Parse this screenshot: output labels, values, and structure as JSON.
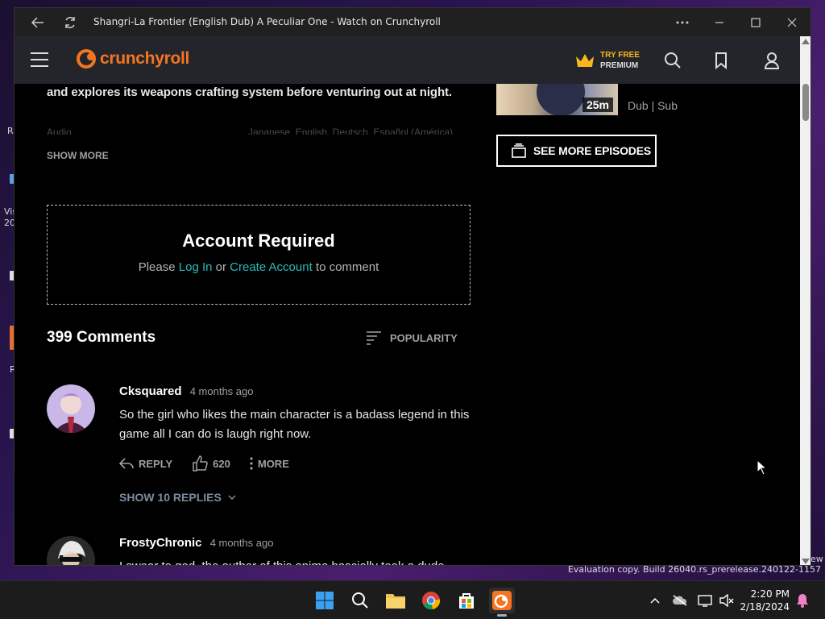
{
  "window": {
    "title": "Shangri-La Frontier (English Dub) A Peculiar One - Watch on Crunchyroll"
  },
  "header": {
    "logo_text": "crunchyroll",
    "premium_try": "TRY FREE",
    "premium_label": "PREMIUM"
  },
  "episode": {
    "description_tail": "and explores its weapons crafting system before venturing out at night.",
    "audio_label": "Audio",
    "audio_values": "Japanese, English, Deutsch, Español (América)",
    "show_more": "SHOW MORE",
    "thumb_duration": "25m",
    "dub_sub": "Dub | Sub",
    "see_more_episodes": "SEE MORE EPISODES"
  },
  "account": {
    "title": "Account Required",
    "prefix": "Please",
    "login": "Log In",
    "or": "or",
    "create": "Create Account",
    "suffix": "to comment"
  },
  "comments": {
    "count_label": "399 Comments",
    "sort_label": "POPULARITY",
    "items": [
      {
        "user": "Cksquared",
        "time": "4 months ago",
        "body": "So the girl who likes the main character is a badass legend in this game all I can do is laugh right now.",
        "reply": "REPLY",
        "likes": "620",
        "more": "MORE",
        "replies": "SHOW 10 REPLIES"
      },
      {
        "user": "FrostyChronic",
        "time": "4 months ago",
        "body": "I swear to god, the author of this anime bascially took a dude"
      }
    ]
  },
  "desktop": {
    "eval_text": "Evaluation copy. Build 26040.rs_prerelease.240122-1157",
    "time": "2:20 PM",
    "date": "2/18/2024",
    "frag_r": "R",
    "frag_vis": "Vis",
    "frag_20": "20",
    "frag_ew": "ew"
  },
  "colors": {
    "brand": "#f47521",
    "link": "#2abdbb",
    "header_bg": "#23252b"
  }
}
